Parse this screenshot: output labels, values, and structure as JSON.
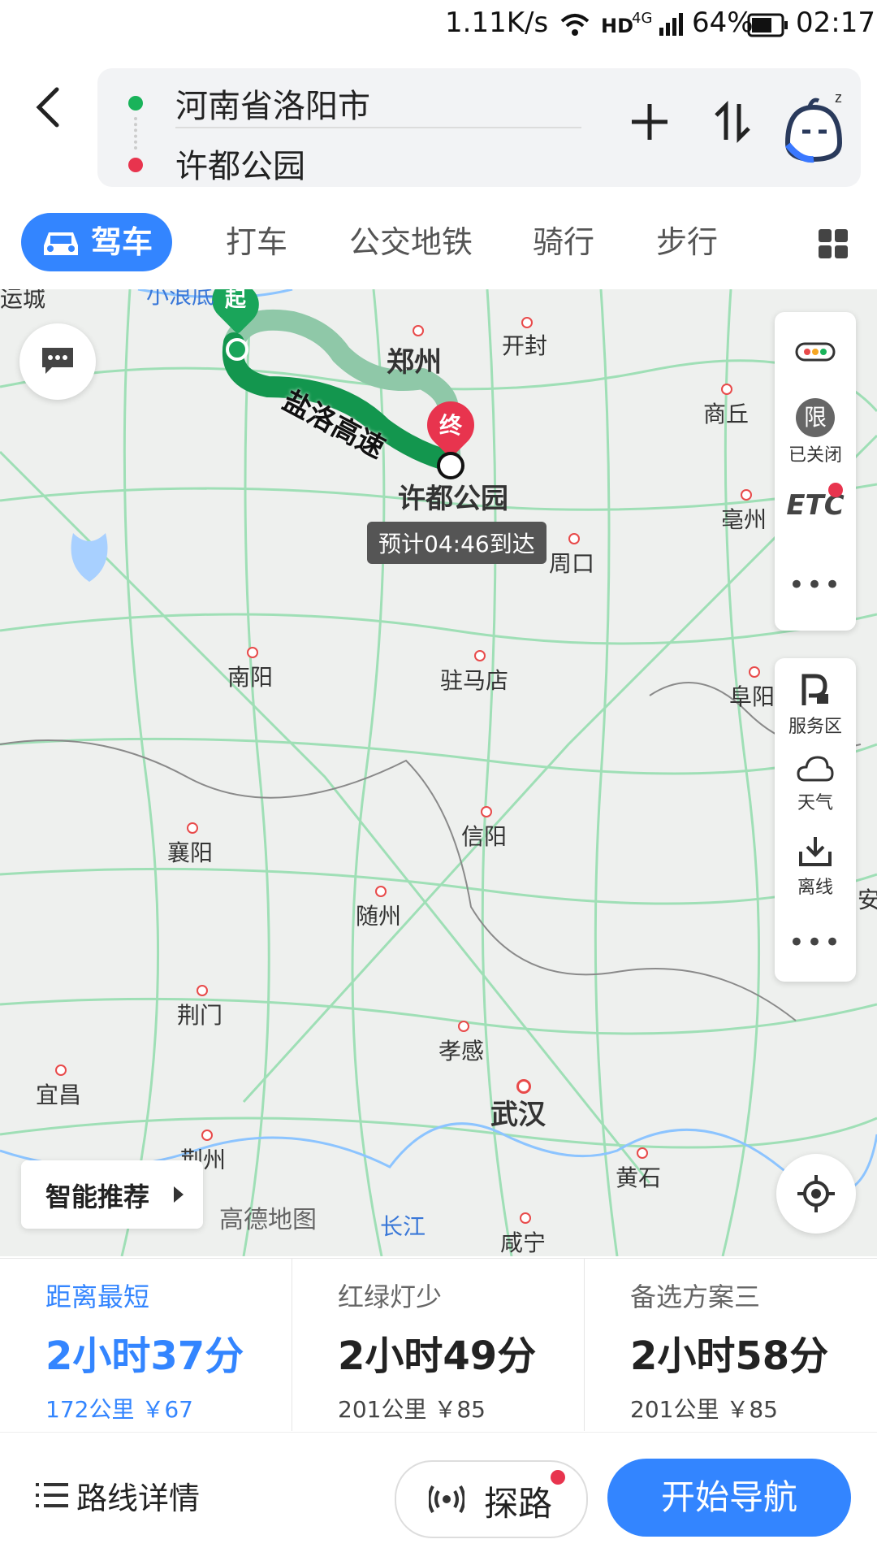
{
  "status_bar": {
    "speed": "1.11K/s",
    "network": "4G",
    "battery": "64%",
    "time": "02:17"
  },
  "header": {
    "origin": "河南省洛阳市",
    "destination": "许都公园"
  },
  "tabs": [
    {
      "label": "驾车",
      "active": true
    },
    {
      "label": "打车"
    },
    {
      "label": "公交地铁"
    },
    {
      "label": "骑行"
    },
    {
      "label": "步行"
    }
  ],
  "map": {
    "start_marker": "起",
    "end_marker": "终",
    "road_label": "盐洛高速",
    "dest_label": "许都公园",
    "eta_label": "预计04:46到达",
    "cities": [
      "运城",
      "小浪底",
      "郑州",
      "开封",
      "商丘",
      "亳州",
      "周口",
      "南阳",
      "驻马店",
      "阜阳",
      "信阳",
      "襄阳",
      "随州",
      "荆门",
      "孝感",
      "宜昌",
      "武汉",
      "荆州",
      "黄石",
      "咸宁",
      "长江",
      "安"
    ],
    "watermark": "高德地图",
    "smart_recommend": "智能推荐",
    "side_tools_top": [
      {
        "icon": "traffic-light-icon",
        "label": ""
      },
      {
        "icon": "restriction-icon",
        "glyph": "限",
        "label": "已关闭"
      },
      {
        "icon": "etc-icon",
        "glyph": "ETC",
        "label": ""
      },
      {
        "icon": "more-icon",
        "label": ""
      }
    ],
    "side_tools_bottom": [
      {
        "icon": "service-area-icon",
        "label": "服务区"
      },
      {
        "icon": "weather-icon",
        "label": "天气"
      },
      {
        "icon": "offline-download-icon",
        "label": "离线"
      },
      {
        "icon": "more-icon",
        "label": ""
      }
    ]
  },
  "routes": [
    {
      "title": "距离最短",
      "time": "2小时37分",
      "detail": "172公里 ￥67",
      "selected": true
    },
    {
      "title": "红绿灯少",
      "time": "2小时49分",
      "detail": "201公里 ￥85"
    },
    {
      "title": "备选方案三",
      "time": "2小时58分",
      "detail": "201公里 ￥85"
    }
  ],
  "bottom": {
    "details": "路线详情",
    "explore": "探路",
    "start_nav": "开始导航"
  },
  "colors": {
    "accent": "#3385ff",
    "route_green": "#19a15f",
    "marker_red": "#e8344e"
  }
}
